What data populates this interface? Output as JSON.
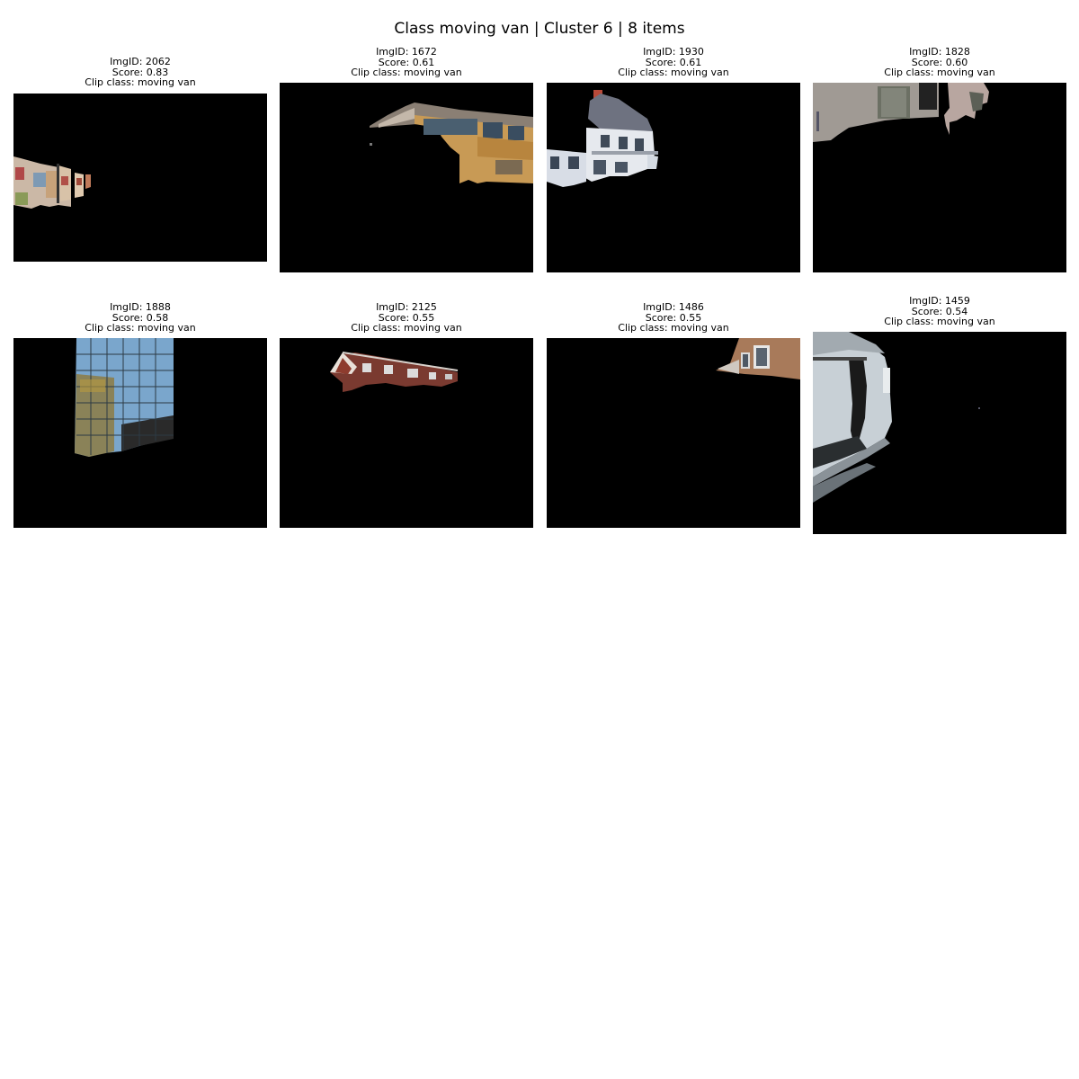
{
  "figure": {
    "title": "Class moving van | Cluster 6 | 8 items"
  },
  "panels": [
    {
      "img_id": "ImgID: 2062",
      "score": "Score: 0.83",
      "clip_class": "Clip class: moving van",
      "content": "masked-buildings-left-edge"
    },
    {
      "img_id": "ImgID: 1672",
      "score": "Score: 0.61",
      "clip_class": "Clip class: moving van",
      "content": "masked-motel-building"
    },
    {
      "img_id": "ImgID: 1930",
      "score": "Score: 0.61",
      "clip_class": "Clip class: moving van",
      "content": "masked-victorian-house"
    },
    {
      "img_id": "ImgID: 1828",
      "score": "Score: 0.60",
      "clip_class": "Clip class: moving van",
      "content": "masked-house-facade"
    },
    {
      "img_id": "ImgID: 1888",
      "score": "Score: 0.58",
      "clip_class": "Clip class: moving van",
      "content": "masked-glass-tower"
    },
    {
      "img_id": "ImgID: 2125",
      "score": "Score: 0.55",
      "clip_class": "Clip class: moving van",
      "content": "masked-brick-bungalow"
    },
    {
      "img_id": "ImgID: 1486",
      "score": "Score: 0.55",
      "clip_class": "Clip class: moving van",
      "content": "masked-brick-corner"
    },
    {
      "img_id": "ImgID: 1459",
      "score": "Score: 0.54",
      "clip_class": "Clip class: moving van",
      "content": "masked-white-wall"
    }
  ],
  "colors": {
    "background": "#ffffff",
    "image_background": "#000000"
  }
}
